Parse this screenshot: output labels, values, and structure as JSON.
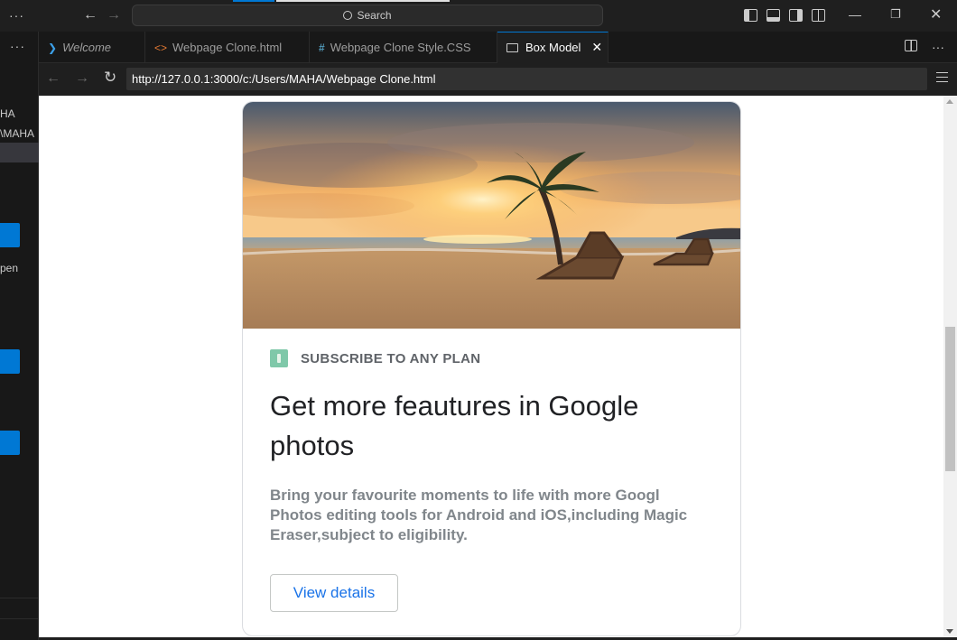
{
  "titlebar": {
    "search_placeholder": "Search",
    "back_icon": "arrow-left-icon",
    "forward_icon": "arrow-right-icon",
    "window_controls": [
      "minimize",
      "restore",
      "close"
    ]
  },
  "sidebar": {
    "fragments": [
      "HA",
      "\\MAHA",
      "pen"
    ]
  },
  "tabs": [
    {
      "label": "Welcome",
      "icon": "vscode-icon",
      "italic": true,
      "active": false
    },
    {
      "label": "Webpage Clone.html",
      "icon": "html-icon",
      "active": false
    },
    {
      "label": "Webpage Clone Style.CSS",
      "icon": "css-hash-icon",
      "active": false
    },
    {
      "label": "Box Model",
      "icon": "preview-icon",
      "active": true
    }
  ],
  "browser": {
    "url": "http://127.0.0.1:3000/c:/Users/MAHA/Webpage Clone.html"
  },
  "card": {
    "eyebrow": "SUBSCRIBE TO ANY PLAN",
    "headline_line1": "Get more feautures in Google",
    "headline_line2": "photos",
    "description": "Bring your favourite moments to life with more Googl Photos editing tools for Android and iOS,including Magic Eraser,subject to eligibility.",
    "button_label": "View details",
    "image_subject": "sunset-beach-with-palm-tree-and-lounge-chairs"
  },
  "colors": {
    "accent": "#0078d4",
    "link_blue": "#1a73e8",
    "eyebrow_icon": "#7fc8a9",
    "editor_bg": "#1f1f1f"
  }
}
